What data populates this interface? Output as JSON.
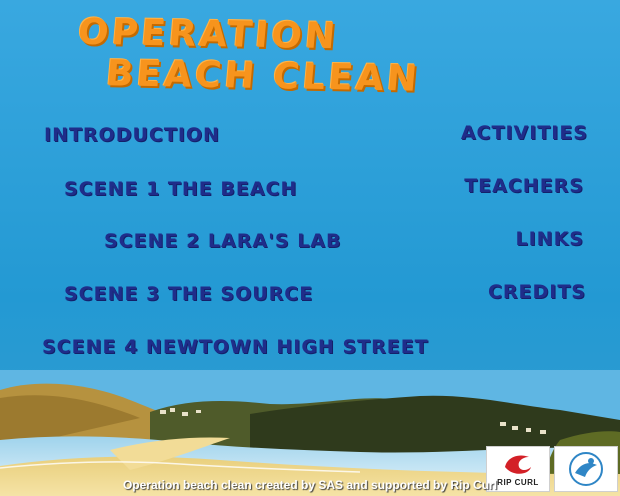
{
  "title": {
    "line1": "Operation",
    "line2": "Beach Clean"
  },
  "menu": {
    "left": [
      {
        "label": "Introduction"
      },
      {
        "label": "Scene 1 the beach"
      },
      {
        "label": "Scene 2 Lara's Lab"
      },
      {
        "label": "Scene 3 the source"
      },
      {
        "label": "Scene 4 Newtown High Street"
      }
    ],
    "right": [
      {
        "label": "Activities"
      },
      {
        "label": "Teachers"
      },
      {
        "label": "Links"
      },
      {
        "label": "Credits"
      }
    ]
  },
  "footer": {
    "credit_text": "Operation beach clean created by SAS and supported by Rip Curl"
  },
  "logos": {
    "ripcurl": {
      "name": "ripcurl-logo",
      "label": "RIP CURL"
    },
    "sas": {
      "name": "sas-logo"
    }
  },
  "colors": {
    "sky": "#2b9fd8",
    "title_orange": "#f7941d",
    "link_navy": "#1f2d8a",
    "sand": "#f1d98a"
  }
}
